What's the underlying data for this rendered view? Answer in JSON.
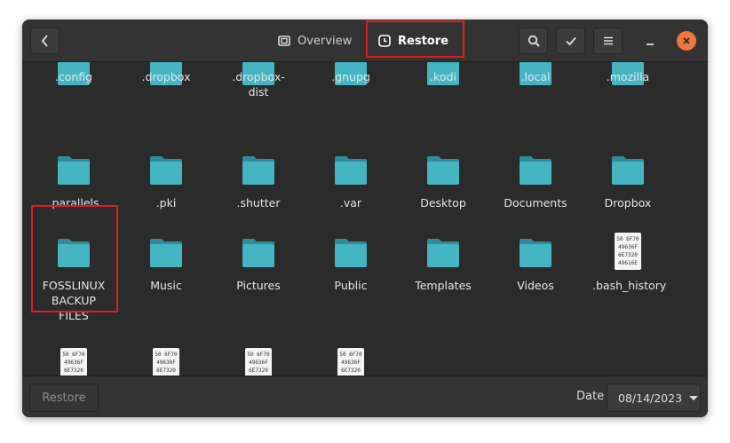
{
  "header": {
    "tabs": [
      {
        "label": "Overview",
        "icon": "overview-icon"
      },
      {
        "label": "Restore",
        "icon": "clock-icon"
      }
    ]
  },
  "grid": {
    "row0": [
      ".config",
      ".dropbox",
      ".dropbox-dist",
      ".gnupg",
      ".kodi",
      ".local",
      ".mozilla"
    ],
    "row1": [
      ".parallels",
      ".pki",
      ".shutter",
      ".var",
      "Desktop",
      "Documents",
      "Dropbox"
    ],
    "row2": [
      "FOSSLINUX BACKUP FILES",
      "Music",
      "Pictures",
      "Public",
      "Templates",
      "Videos",
      ".bash_history"
    ],
    "text_icon_lines": [
      "50 6F70",
      "49636F",
      "6E7320",
      "49616E"
    ]
  },
  "footer": {
    "restore_label": "Restore",
    "date_label": "Date",
    "date_value": "08/14/2023"
  },
  "colors": {
    "folder": "#45b5c4",
    "folder_tab": "#2f8d9a",
    "highlight": "#e01b24",
    "close": "#f0763b"
  }
}
